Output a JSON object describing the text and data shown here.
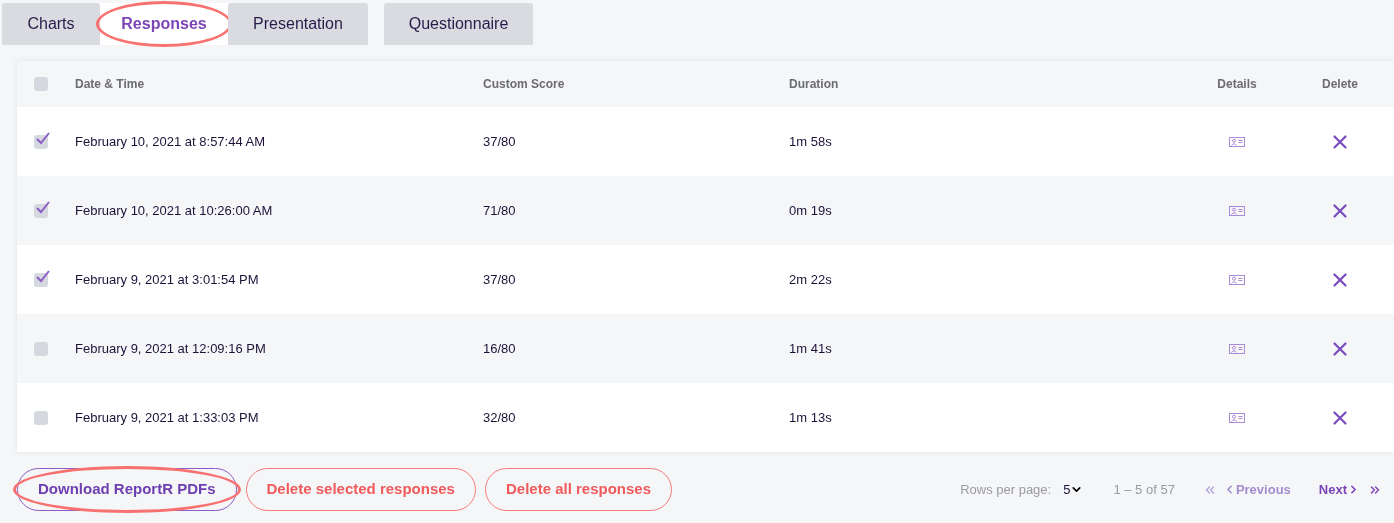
{
  "tabs": [
    {
      "label": "Charts",
      "selected": false,
      "highlighted": false
    },
    {
      "label": "Responses",
      "selected": true,
      "highlighted": true
    },
    {
      "label": "Presentation",
      "selected": false,
      "highlighted": false
    },
    {
      "label": "Questionnaire",
      "selected": false,
      "highlighted": false
    }
  ],
  "table": {
    "select_all": {
      "checked": false
    },
    "columns": [
      "Date & Time",
      "Custom Score",
      "Duration",
      "Details",
      "Delete"
    ],
    "rows": [
      {
        "checked": true,
        "date_time": "February 10, 2021 at 8:57:44 AM",
        "custom_score": "37/80",
        "duration": "1m 58s"
      },
      {
        "checked": true,
        "date_time": "February 10, 2021 at 10:26:00 AM",
        "custom_score": "71/80",
        "duration": "0m 19s"
      },
      {
        "checked": true,
        "date_time": "February 9, 2021 at 3:01:54 PM",
        "custom_score": "37/80",
        "duration": "2m 22s"
      },
      {
        "checked": false,
        "date_time": "February 9, 2021 at 12:09:16 PM",
        "custom_score": "16/80",
        "duration": "1m 41s"
      },
      {
        "checked": false,
        "date_time": "February 9, 2021 at 1:33:03 PM",
        "custom_score": "32/80",
        "duration": "1m 13s"
      }
    ]
  },
  "actions": [
    {
      "label": "Download ReportR PDFs",
      "kind": "primary",
      "highlighted": true
    },
    {
      "label": "Delete selected responses",
      "kind": "danger",
      "highlighted": false
    },
    {
      "label": "Delete all responses",
      "kind": "danger",
      "highlighted": false
    }
  ],
  "pagination": {
    "rows_per_page_label": "Rows per page:",
    "rows_per_page": "5",
    "range": "1 – 5 of 57",
    "previous": {
      "label": "Previous",
      "disabled": true
    },
    "next": {
      "label": "Next",
      "disabled": false
    },
    "first_disabled": true,
    "last_disabled": false
  }
}
